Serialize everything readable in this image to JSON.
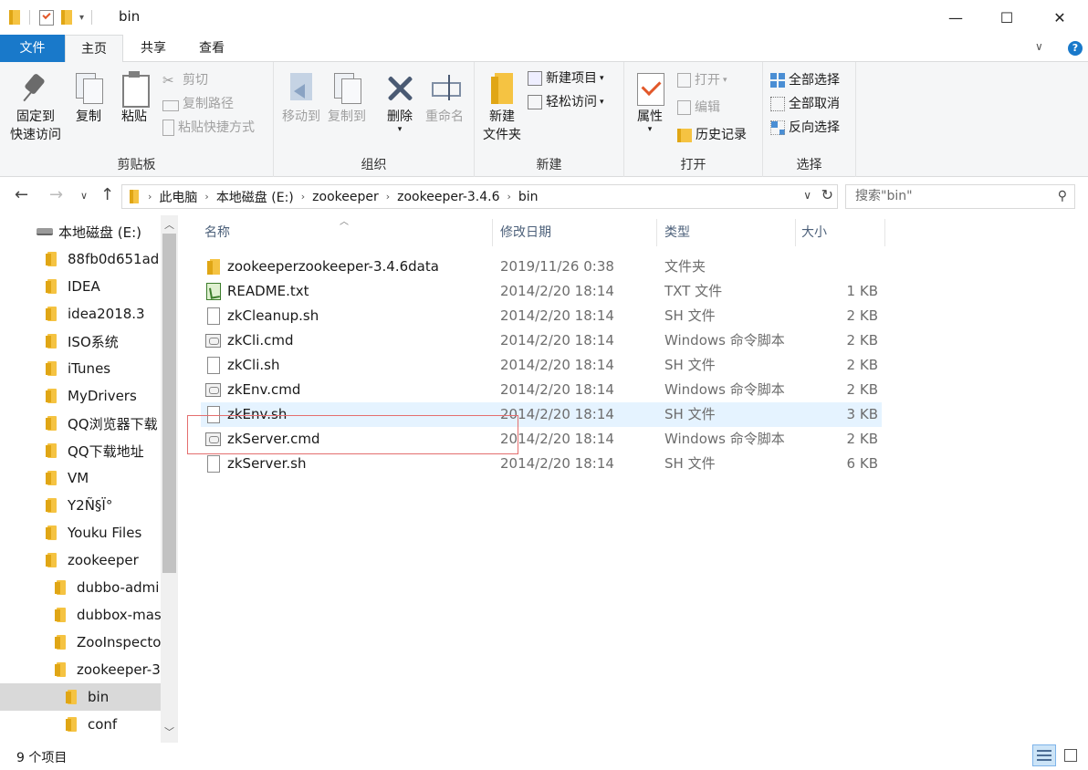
{
  "window": {
    "title": "bin",
    "minimize": "—",
    "maximize": "☐",
    "close": "✕"
  },
  "tabs": [
    {
      "label": "文件"
    },
    {
      "label": "主页"
    },
    {
      "label": "共享"
    },
    {
      "label": "查看"
    }
  ],
  "ribbon": {
    "clipboard": {
      "label": "剪贴板",
      "pin_line1": "固定到",
      "pin_line2": "快速访问",
      "copy": "复制",
      "paste": "粘贴",
      "cut": "剪切",
      "copy_path": "复制路径",
      "paste_shortcut": "粘贴快捷方式"
    },
    "organize": {
      "label": "组织",
      "move_to": "移动到",
      "copy_to": "复制到",
      "delete": "删除",
      "rename": "重命名"
    },
    "new": {
      "label": "新建",
      "new_folder_line1": "新建",
      "new_folder_line2": "文件夹",
      "new_item": "新建项目",
      "easy_access": "轻松访问"
    },
    "open": {
      "label": "打开",
      "properties": "属性",
      "open": "打开",
      "edit": "编辑",
      "history": "历史记录"
    },
    "select": {
      "label": "选择",
      "select_all": "全部选择",
      "select_none": "全部取消",
      "invert": "反向选择"
    }
  },
  "address": {
    "crumbs": [
      "此电脑",
      "本地磁盘 (E:)",
      "zookeeper",
      "zookeeper-3.4.6",
      "bin"
    ],
    "search_placeholder": "搜索\"bin\""
  },
  "nav": {
    "items": [
      {
        "label": "本地磁盘 (E:)",
        "type": "drive",
        "indent": 0
      },
      {
        "label": "88fb0d651ad",
        "type": "folder",
        "indent": 1
      },
      {
        "label": "IDEA",
        "type": "folder",
        "indent": 1
      },
      {
        "label": "idea2018.3",
        "type": "folder",
        "indent": 1
      },
      {
        "label": "ISO系统",
        "type": "folder",
        "indent": 1
      },
      {
        "label": "iTunes",
        "type": "folder",
        "indent": 1
      },
      {
        "label": "MyDrivers",
        "type": "folder",
        "indent": 1
      },
      {
        "label": "QQ浏览器下载",
        "type": "folder",
        "indent": 1
      },
      {
        "label": "QQ下载地址",
        "type": "folder",
        "indent": 1
      },
      {
        "label": "VM",
        "type": "folder",
        "indent": 1
      },
      {
        "label": "Y2Ñ§Ï°",
        "type": "folder",
        "indent": 1
      },
      {
        "label": "Youku Files",
        "type": "folder",
        "indent": 1
      },
      {
        "label": "zookeeper",
        "type": "folder",
        "indent": 1
      },
      {
        "label": "dubbo-admi",
        "type": "folder",
        "indent": 2
      },
      {
        "label": "dubbox-mas",
        "type": "folder",
        "indent": 2
      },
      {
        "label": "ZooInspecto",
        "type": "folder",
        "indent": 2
      },
      {
        "label": "zookeeper-3",
        "type": "folder",
        "indent": 2
      },
      {
        "label": "bin",
        "type": "folder",
        "indent": 3,
        "selected": true
      },
      {
        "label": "conf",
        "type": "folder",
        "indent": 3
      }
    ]
  },
  "columns": {
    "name": "名称",
    "modified": "修改日期",
    "type": "类型",
    "size": "大小"
  },
  "files": [
    {
      "name": "zookeeperzookeeper-3.4.6data",
      "modified": "2019/11/26 0:38",
      "type": "文件夹",
      "size": "",
      "icon": "folder-icon"
    },
    {
      "name": "README.txt",
      "modified": "2014/2/20 18:14",
      "type": "TXT 文件",
      "size": "1 KB",
      "icon": "text-file-icon"
    },
    {
      "name": "zkCleanup.sh",
      "modified": "2014/2/20 18:14",
      "type": "SH 文件",
      "size": "2 KB",
      "icon": "file-icon"
    },
    {
      "name": "zkCli.cmd",
      "modified": "2014/2/20 18:14",
      "type": "Windows 命令脚本",
      "size": "2 KB",
      "icon": "cmd-file-icon"
    },
    {
      "name": "zkCli.sh",
      "modified": "2014/2/20 18:14",
      "type": "SH 文件",
      "size": "2 KB",
      "icon": "file-icon"
    },
    {
      "name": "zkEnv.cmd",
      "modified": "2014/2/20 18:14",
      "type": "Windows 命令脚本",
      "size": "2 KB",
      "icon": "cmd-file-icon"
    },
    {
      "name": "zkEnv.sh",
      "modified": "2014/2/20 18:14",
      "type": "SH 文件",
      "size": "3 KB",
      "icon": "file-icon",
      "hover": true
    },
    {
      "name": "zkServer.cmd",
      "modified": "2014/2/20 18:14",
      "type": "Windows 命令脚本",
      "size": "2 KB",
      "icon": "cmd-file-icon"
    },
    {
      "name": "zkServer.sh",
      "modified": "2014/2/20 18:14",
      "type": "SH 文件",
      "size": "6 KB",
      "icon": "file-icon"
    }
  ],
  "status": {
    "item_count": "9 个项目"
  },
  "colors": {
    "accent": "#1979ca",
    "hover_row": "#e5f3ff",
    "highlight_border": "#e46e6e"
  }
}
